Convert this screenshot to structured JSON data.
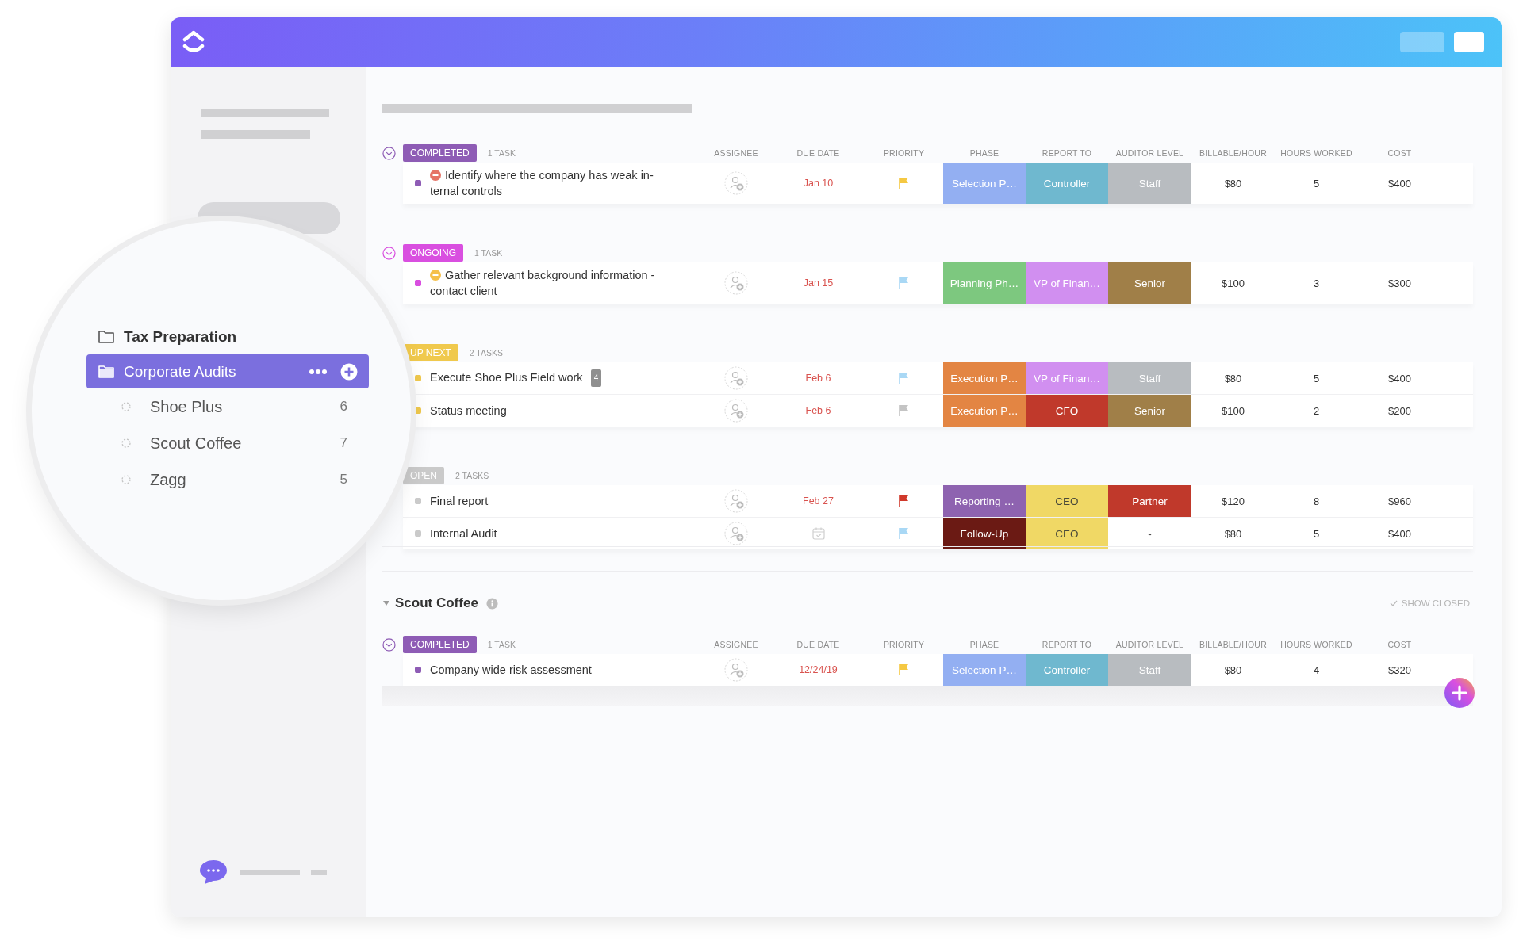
{
  "sidebar": {
    "folders": [
      {
        "name": "Tax Preparation",
        "selected": false
      },
      {
        "name": "Corporate Audits",
        "selected": true,
        "children": [
          {
            "name": "Shoe Plus",
            "count": "6",
            "selected": false
          },
          {
            "name": "Scout Coffee",
            "count": "7",
            "selected": false
          },
          {
            "name": "Zagg",
            "count": "5",
            "selected": false
          }
        ]
      }
    ]
  },
  "sections": [
    {
      "columns": [
        "ASSIGNEE",
        "DUE DATE",
        "PRIORITY",
        "PHASE",
        "REPORT TO",
        "AUDITOR LEVEL",
        "BILLABLE/HOUR",
        "HOURS WORKED",
        "COST"
      ],
      "groups": [
        {
          "status": "COMPLETED",
          "color": "#8e5cb5",
          "count": "1 TASK",
          "toggle": true,
          "tasks": [
            {
              "name": "Identify where the company has weak in-ternal controls",
              "indicator": {
                "color": "#e57366"
              },
              "due": "Jan 10",
              "priority": {
                "color": "#f5c842"
              },
              "phase": {
                "text": "Selection P…",
                "color": "#93aff2"
              },
              "report_to": {
                "text": "Controller",
                "color": "#6fb8cf"
              },
              "auditor_level": {
                "text": "Staff",
                "color": "#b8bcc0"
              },
              "billable": "$80",
              "hours": "5",
              "cost": "$400"
            }
          ]
        },
        {
          "status": "ONGOING",
          "color": "#d94fe0",
          "count": "1 TASK",
          "toggle": true,
          "tasks": [
            {
              "name": "Gather relevant background information - contact client",
              "indicator": {
                "color": "#f5c04a"
              },
              "due": "Jan 15",
              "priority": {
                "color": "#a9d8f5"
              },
              "phase": {
                "text": "Planning Ph…",
                "color": "#7dc87f"
              },
              "report_to": {
                "text": "VP of Finan…",
                "color": "#d18ff0"
              },
              "auditor_level": {
                "text": "Senior",
                "color": "#a07f48"
              },
              "billable": "$100",
              "hours": "3",
              "cost": "$300"
            }
          ]
        },
        {
          "status": "UP NEXT",
          "color": "#f0c94d",
          "count": "2 TASKS",
          "tasks": [
            {
              "name": "Execute Shoe Plus Field work",
              "subtasks": "4",
              "due": "Feb 6",
              "priority": {
                "color": "#a9d8f5"
              },
              "phase": {
                "text": "Execution P…",
                "color": "#e38543"
              },
              "report_to": {
                "text": "VP of Finan…",
                "color": "#d18ff0"
              },
              "auditor_level": {
                "text": "Staff",
                "color": "#b8bcc0"
              },
              "billable": "$80",
              "hours": "5",
              "cost": "$400"
            },
            {
              "name": "Status meeting",
              "due": "Feb 6",
              "priority": {
                "color": "#c4c4c4"
              },
              "phase": {
                "text": "Execution P…",
                "color": "#e38543"
              },
              "report_to": {
                "text": "CFO",
                "color": "#c0392b"
              },
              "auditor_level": {
                "text": "Senior",
                "color": "#a07f48"
              },
              "billable": "$100",
              "hours": "2",
              "cost": "$200"
            }
          ]
        },
        {
          "status": "OPEN",
          "color": "#cacaca",
          "count": "2 TASKS",
          "tasks": [
            {
              "name": "Final report",
              "due": "Feb 27",
              "priority": {
                "color": "#d0392b"
              },
              "phase": {
                "text": "Reporting …",
                "color": "#8e63b0"
              },
              "report_to": {
                "text": "CEO",
                "color": "#f0d865"
              },
              "auditor_level": {
                "text": "Partner",
                "color": "#c0392b"
              },
              "billable": "$120",
              "hours": "8",
              "cost": "$960"
            },
            {
              "name": "Internal Audit",
              "priority": {
                "color": "#a9d8f5"
              },
              "phase": {
                "text": "Follow-Up",
                "color": "#6b1a14"
              },
              "report_to": {
                "text": "CEO",
                "color": "#f0d865"
              },
              "auditor_level": {
                "text": "-"
              },
              "billable": "$80",
              "hours": "5",
              "cost": "$400"
            }
          ]
        }
      ]
    },
    {
      "title": "Scout Coffee",
      "show_closed": "SHOW CLOSED",
      "columns": [
        "ASSIGNEE",
        "DUE DATE",
        "PRIORITY",
        "PHASE",
        "REPORT TO",
        "AUDITOR LEVEL",
        "BILLABLE/HOUR",
        "HOURS WORKED",
        "COST"
      ],
      "groups": [
        {
          "status": "COMPLETED",
          "color": "#8e5cb5",
          "count": "1 TASK",
          "toggle": true,
          "tasks": [
            {
              "name": "Company wide risk assessment",
              "due": "12/24/19",
              "priority": {
                "color": "#f5c842"
              },
              "phase": {
                "text": "Selection P…",
                "color": "#93aff2"
              },
              "report_to": {
                "text": "Controller",
                "color": "#6fb8cf"
              },
              "auditor_level": {
                "text": "Staff",
                "color": "#b8bcc0"
              },
              "billable": "$80",
              "hours": "4",
              "cost": "$320"
            }
          ]
        }
      ]
    }
  ]
}
